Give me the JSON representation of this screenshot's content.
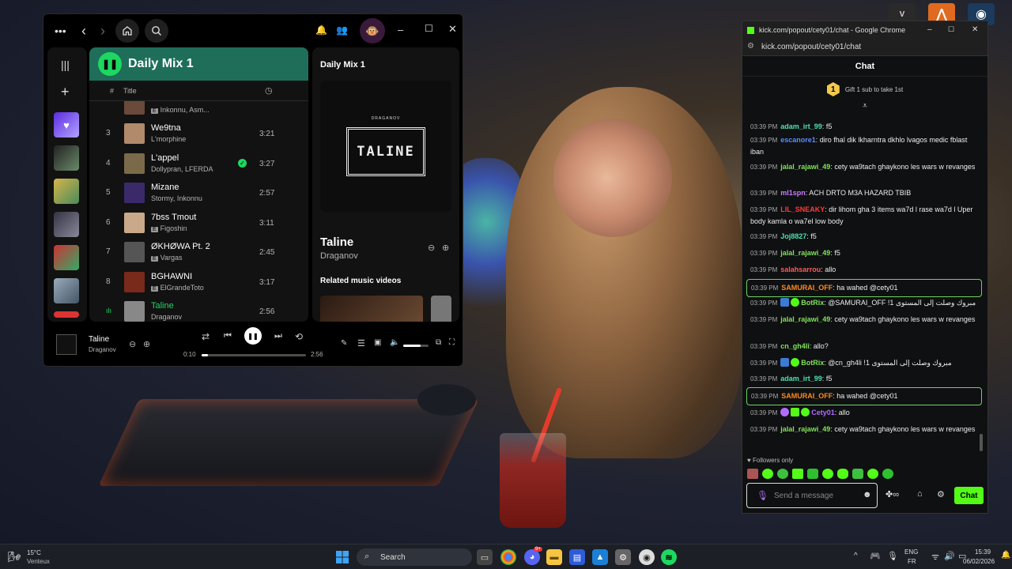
{
  "spotify": {
    "playlist_title": "Daily Mix 1",
    "col_hash": "#",
    "col_title": "Title",
    "partial_row_artist": "Inkonnu, Asm...",
    "tracks": [
      {
        "num": "3",
        "title": "We9tna",
        "artist": "L'morphine",
        "duration": "3:21",
        "explicit": false
      },
      {
        "num": "4",
        "title": "L'appel",
        "artist": "Dollypran, LFERDA",
        "duration": "3:27",
        "explicit": false,
        "saved": true
      },
      {
        "num": "5",
        "title": "Mizane",
        "artist": "Stormy, Inkonnu",
        "duration": "2:57",
        "explicit": false
      },
      {
        "num": "6",
        "title": "7bss Tmout",
        "artist": "Figoshin",
        "duration": "3:11",
        "explicit": true
      },
      {
        "num": "7",
        "title": "ØKHØWA Pt. 2",
        "artist": "Vargas",
        "duration": "2:45",
        "explicit": true
      },
      {
        "num": "8",
        "title": "BGHAWNI",
        "artist": "ElGrandeToto",
        "duration": "3:17",
        "explicit": true
      },
      {
        "num": "",
        "title": "Taline",
        "artist": "Draganov",
        "duration": "2:56",
        "explicit": false,
        "playing": true
      }
    ],
    "right_panel": {
      "title": "Daily Mix 1",
      "art_label": "DRAGANOV",
      "art_word": "TALINE",
      "song": "Taline",
      "artist": "Draganov",
      "related": "Related music videos"
    },
    "player": {
      "song": "Taline",
      "artist": "Draganov",
      "elapsed": "0:10",
      "total": "2:56",
      "progress_fraction": 0.057,
      "volume_fraction": 0.7
    }
  },
  "chrome": {
    "title": "kick.com/popout/cety01/chat - Google Chrome",
    "url": "kick.com/popout/cety01/chat",
    "chat_header": "Chat",
    "gift_text": "Gift 1 sub to take 1st",
    "gift_number": "1",
    "followers_only": "Followers only",
    "input_placeholder": "Send a message",
    "chat_button": "Chat",
    "messages": [
      {
        "time": "03:39 PM",
        "user": "adam_irt_99",
        "color": "#4fe0b0",
        "text": "f5"
      },
      {
        "time": "03:39 PM",
        "user": "escanore1",
        "color": "#5b8cff",
        "text": "diro fhal dik lkharntra dkhlo lvagos medic fblast iban"
      },
      {
        "time": "03:39 PM",
        "user": "jalal_rajawi_49",
        "color": "#7fe35a",
        "text": "cety wa9tach ghaykono les wars w revanges"
      },
      {
        "time": "03:39 PM",
        "user": "ml1spn",
        "color": "#c77dff",
        "text": "ACH DRTO M3A HAZARD TBIB"
      },
      {
        "time": "03:39 PM",
        "user": "LIL_SNEAKY",
        "color": "#ff3b3b",
        "text": "dir lihom gha 3 items wa7d l rase wa7d l Uper body kamla o wa7el low body"
      },
      {
        "time": "03:39 PM",
        "user": "Joj8827",
        "color": "#4fe0b0",
        "text": "f5"
      },
      {
        "time": "03:39 PM",
        "user": "jalal_rajawi_49",
        "color": "#7fe35a",
        "text": "f5"
      },
      {
        "time": "03:39 PM",
        "user": "salahsarrou",
        "color": "#ff5a5a",
        "text": "allo"
      },
      {
        "time": "03:39 PM",
        "user": "SAMURAI_OFF",
        "color": "#ff8a1f",
        "text": "ha wahed @cety01",
        "highlight": true
      },
      {
        "time": "03:39 PM",
        "user": "BotRix",
        "color": "#7fe35a",
        "text": "@SAMURAI_OFF !مبروك وصلت إلى المستوى 1",
        "bot": true
      },
      {
        "time": "03:39 PM",
        "user": "jalal_rajawi_49",
        "color": "#7fe35a",
        "text": "cety wa9tach ghaykono les wars w revanges"
      },
      {
        "time": "03:39 PM",
        "user": "cn_gh4li",
        "color": "#7fe35a",
        "text": "allo?"
      },
      {
        "time": "03:39 PM",
        "user": "BotRix",
        "color": "#7fe35a",
        "text": "@cn_gh4li !مبروك وصلت إلى المستوى 1",
        "bot": true
      },
      {
        "time": "03:39 PM",
        "user": "adam_irt_99",
        "color": "#4fe0b0",
        "text": "f5"
      },
      {
        "time": "03:39 PM",
        "user": "SAMURAI_OFF",
        "color": "#ff8a1f",
        "text": "ha wahed @cety01",
        "highlight": true
      },
      {
        "time": "03:39 PM",
        "user": "Cety01",
        "color": "#b06bff",
        "text": "allo",
        "owner": true
      },
      {
        "time": "03:39 PM",
        "user": "jalal_rajawi_49",
        "color": "#7fe35a",
        "text": "cety wa9tach ghaykono les wars w revanges"
      }
    ]
  },
  "taskbar": {
    "weather_temp": "15°C",
    "weather_desc": "Venteux",
    "search_label": "Search",
    "lang_top": "ENG",
    "lang_bottom": "FR",
    "time": "15:39",
    "date": "06/02/2026",
    "discord_badge": "9+"
  }
}
